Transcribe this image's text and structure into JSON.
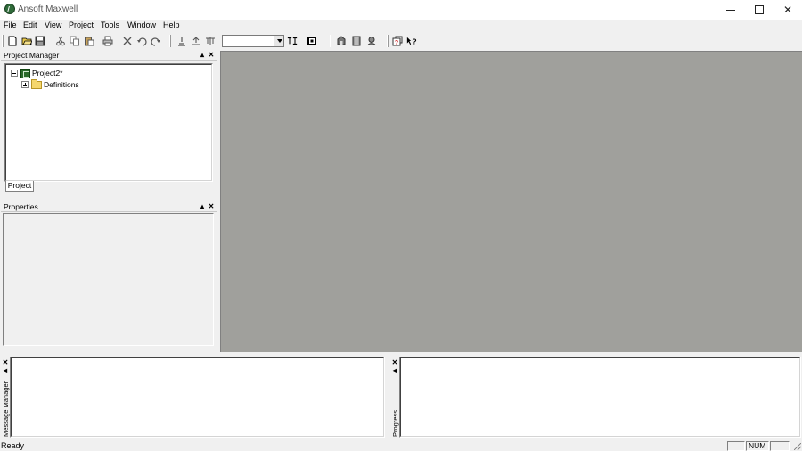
{
  "window": {
    "title": "Ansoft Maxwell",
    "icon": "ansoft-maxwell-logo-icon"
  },
  "menu": [
    "File",
    "Edit",
    "View",
    "Project",
    "Tools",
    "Window",
    "Help"
  ],
  "toolbar": {
    "combo_value": "",
    "icons": [
      "new-icon",
      "open-icon",
      "save-icon",
      "cut-icon",
      "copy-icon",
      "paste-icon",
      "print-icon",
      "delete-icon",
      "undo-icon",
      "redo-icon",
      "insert-icon-1",
      "insert-icon-2",
      "insert-icon-3",
      "design-icon",
      "validate-icon",
      "analyze-icon",
      "results-icon",
      "fields-icon",
      "about-icon",
      "context-help-icon"
    ]
  },
  "project_manager": {
    "title": "Project Manager",
    "tree": [
      {
        "label": "Project2*",
        "expanded": true,
        "icon": "project-icon"
      },
      {
        "label": "Definitions",
        "expanded": false,
        "icon": "folder-icon"
      }
    ],
    "tab": "Project"
  },
  "properties": {
    "title": "Properties"
  },
  "message_manager": {
    "title": "Message Manager"
  },
  "progress": {
    "title": "Progress"
  },
  "statusbar": {
    "text": "Ready",
    "num": "NUM"
  }
}
